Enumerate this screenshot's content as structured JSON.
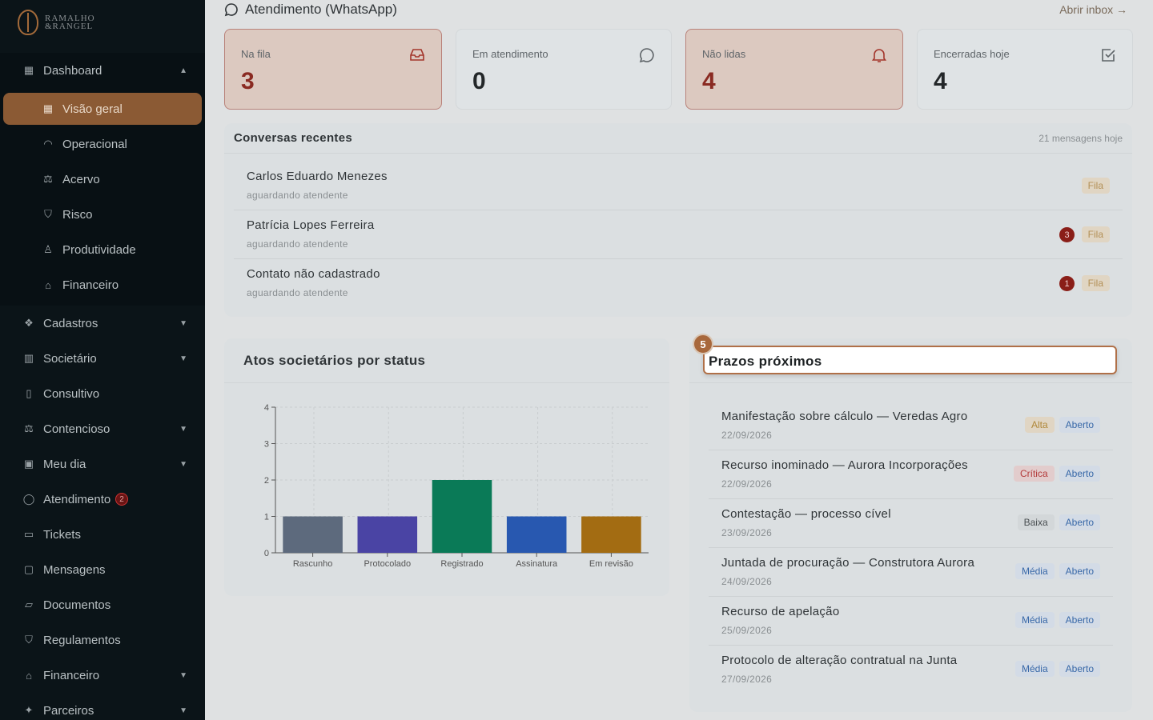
{
  "brand": {
    "line1": "RAMALHO",
    "line2": "&RANGEL"
  },
  "sidebar": {
    "dashboard": {
      "label": "Dashboard"
    },
    "sub": [
      {
        "label": "Visão geral"
      },
      {
        "label": "Operacional"
      },
      {
        "label": "Acervo"
      },
      {
        "label": "Risco"
      },
      {
        "label": "Produtividade"
      },
      {
        "label": "Financeiro"
      }
    ],
    "items": [
      {
        "label": "Cadastros"
      },
      {
        "label": "Societário"
      },
      {
        "label": "Consultivo"
      },
      {
        "label": "Contencioso"
      },
      {
        "label": "Meu dia"
      },
      {
        "label": "Atendimento",
        "badge": "2"
      },
      {
        "label": "Tickets"
      },
      {
        "label": "Mensagens"
      },
      {
        "label": "Documentos"
      },
      {
        "label": "Regulamentos"
      },
      {
        "label": "Financeiro"
      },
      {
        "label": "Parceiros"
      }
    ]
  },
  "section": {
    "title": "Atendimento (WhatsApp)",
    "link": "Abrir inbox →"
  },
  "stats": [
    {
      "label": "Na fila",
      "value": "3"
    },
    {
      "label": "Em atendimento",
      "value": "0"
    },
    {
      "label": "Não lidas",
      "value": "4"
    },
    {
      "label": "Encerradas hoje",
      "value": "4"
    }
  ],
  "conversations": {
    "title": "Conversas recentes",
    "count": "21 mensagens hoje",
    "rows": [
      {
        "name": "Carlos Eduardo Menezes",
        "sub": "aguardando atendente",
        "status": "Fila",
        "unread": ""
      },
      {
        "name": "Patrícia Lopes Ferreira",
        "sub": "aguardando atendente",
        "status": "Fila",
        "unread": "3"
      },
      {
        "name": "Contato não cadastrado",
        "sub": "aguardando atendente",
        "status": "Fila",
        "unread": "1"
      }
    ]
  },
  "chart_card": {
    "title": "Atos societários por status"
  },
  "chart_data": {
    "type": "bar",
    "categories": [
      "Rascunho",
      "Protocolado",
      "Registrado",
      "Assinatura",
      "Em revisão"
    ],
    "values": [
      1,
      1,
      2,
      1,
      1
    ],
    "colors": [
      "#5d6a7d",
      "#4a44a4",
      "#0a7a57",
      "#2858b0",
      "#a36c12"
    ],
    "yticks": [
      "0",
      "1",
      "2",
      "3",
      "4"
    ],
    "ylim": [
      0,
      4
    ],
    "grid": true
  },
  "deadlines": {
    "step": "5",
    "title": "Prazos próximos",
    "rows": [
      {
        "name": "Manifestação sobre cálculo — Veredas Agro",
        "date": "22/09/2026",
        "priority": "Alta",
        "status": "Aberto"
      },
      {
        "name": "Recurso inominado — Aurora Incorporações",
        "date": "22/09/2026",
        "priority": "Crítica",
        "status": "Aberto"
      },
      {
        "name": "Contestação — processo cível",
        "date": "23/09/2026",
        "priority": "Baixa",
        "status": "Aberto"
      },
      {
        "name": "Juntada de procuração — Construtora Aurora",
        "date": "24/09/2026",
        "priority": "Média",
        "status": "Aberto"
      },
      {
        "name": "Recurso de apelação",
        "date": "25/09/2026",
        "priority": "Média",
        "status": "Aberto"
      },
      {
        "name": "Protocolo de alteração contratual na Junta",
        "date": "27/09/2026",
        "priority": "Média",
        "status": "Aberto"
      }
    ]
  }
}
